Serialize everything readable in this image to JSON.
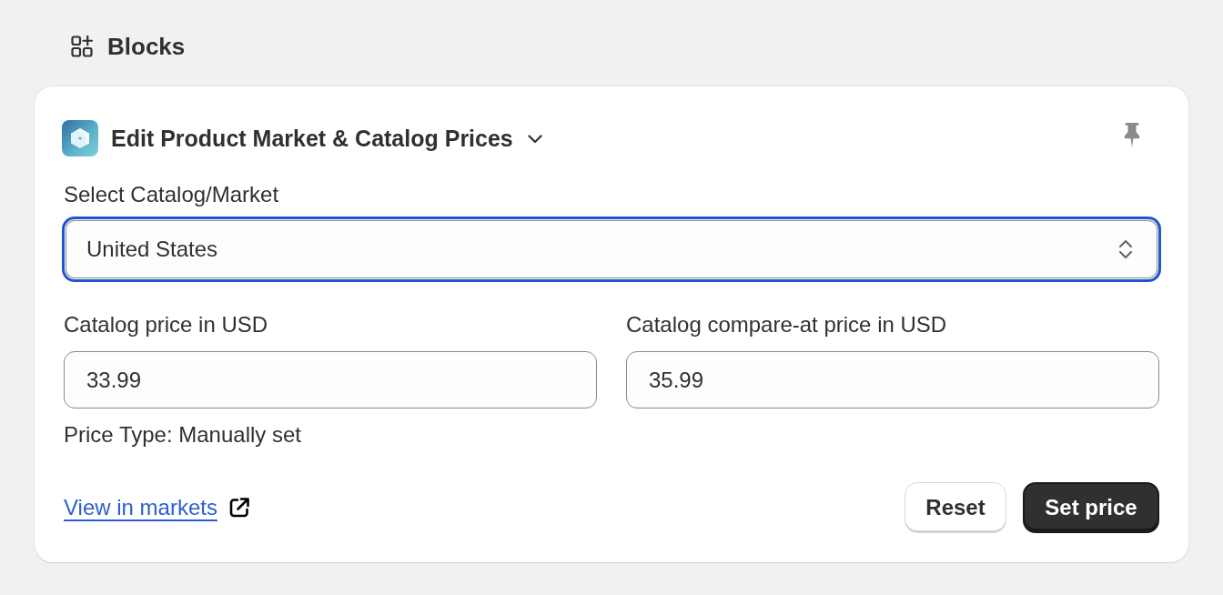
{
  "section": {
    "title": "Blocks"
  },
  "card": {
    "title": "Edit Product Market & Catalog Prices",
    "market_select": {
      "label": "Select Catalog/Market",
      "value": "United States",
      "focused": true
    },
    "price_fields": [
      {
        "label": "Catalog price in USD",
        "value": "33.99"
      },
      {
        "label": "Catalog compare-at price in USD",
        "value": "35.99"
      }
    ],
    "price_type": "Price Type: Manually set",
    "link": {
      "label": "View in markets"
    },
    "buttons": [
      {
        "label": "Reset",
        "kind": "secondary"
      },
      {
        "label": "Set price",
        "kind": "primary"
      }
    ]
  }
}
